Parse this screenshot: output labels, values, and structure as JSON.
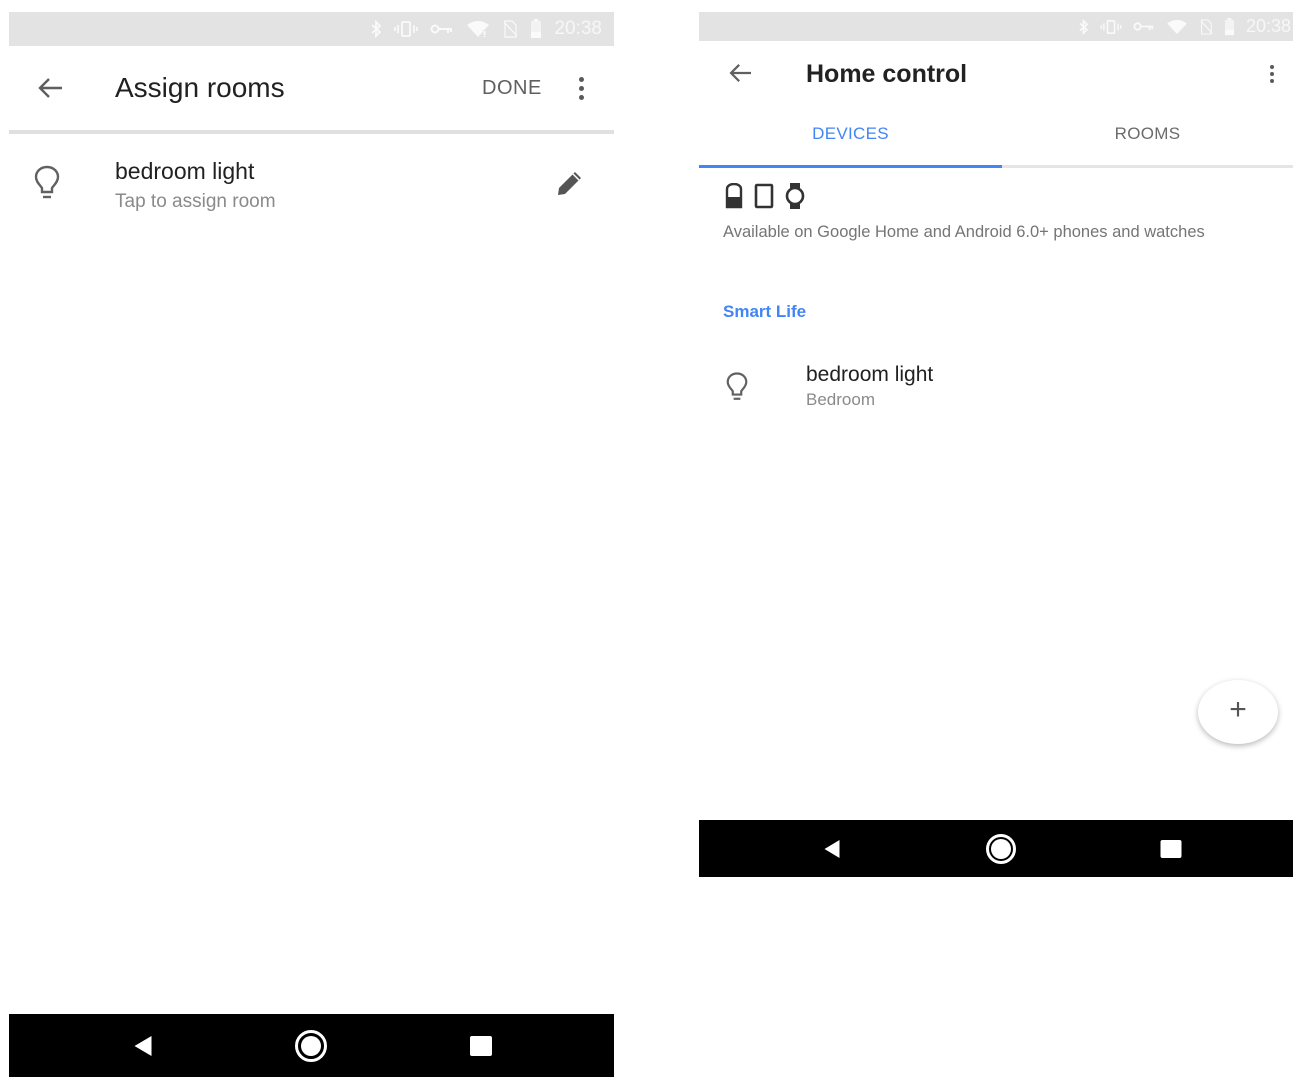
{
  "left": {
    "status": {
      "time": "20:38"
    },
    "appbar": {
      "title": "Assign rooms",
      "done_label": "DONE"
    },
    "devices": [
      {
        "name": "bedroom light",
        "subtitle": "Tap to assign room"
      }
    ]
  },
  "right": {
    "status": {
      "time": "20:38"
    },
    "appbar": {
      "title": "Home control"
    },
    "tabs": [
      {
        "label": "DEVICES",
        "active": true
      },
      {
        "label": "ROOMS",
        "active": false
      }
    ],
    "availability_text": "Available on Google Home and Android 6.0+ phones and watches",
    "section_title": "Smart Life",
    "devices": [
      {
        "name": "bedroom light",
        "room": "Bedroom"
      }
    ],
    "fab_label": "+"
  },
  "colors": {
    "accent": "#4285f4",
    "statusbar": "#e3e3e3",
    "navbar": "#000000"
  },
  "icons": [
    "bluetooth-icon",
    "vibrate-icon",
    "vpn-key-icon",
    "wifi-icon",
    "no-sim-icon",
    "battery-icon",
    "back-arrow-icon",
    "more-vert-icon",
    "lightbulb-icon",
    "pencil-icon",
    "google-home-icon",
    "phone-icon",
    "watch-icon",
    "add-icon",
    "nav-back-icon",
    "nav-home-icon",
    "nav-recents-icon"
  ]
}
